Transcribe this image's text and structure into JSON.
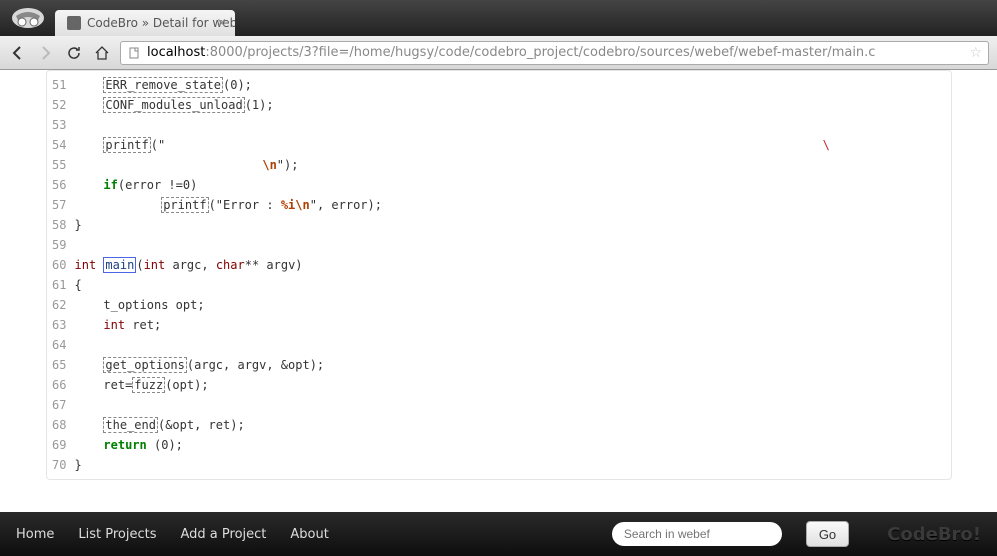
{
  "window": {
    "tab_title": "CodeBro » Detail for web"
  },
  "address": {
    "host": "localhost",
    "path": ":8000/projects/3?file=/home/hugsy/code/codebro_project/codebro/sources/webef/webef-master/main.c"
  },
  "code": {
    "lines": [
      {
        "n": 51,
        "tokens": [
          [
            "plain",
            "    "
          ],
          [
            "link",
            "ERR_remove_state"
          ],
          [
            "plain",
            "(0);"
          ]
        ]
      },
      {
        "n": 52,
        "tokens": [
          [
            "plain",
            "    "
          ],
          [
            "link",
            "CONF_modules_unload"
          ],
          [
            "plain",
            "(1);"
          ]
        ]
      },
      {
        "n": 53,
        "tokens": [
          [
            "plain",
            ""
          ]
        ]
      },
      {
        "n": 54,
        "tokens": [
          [
            "plain",
            "    "
          ],
          [
            "link",
            "printf"
          ],
          [
            "plain",
            "(\""
          ],
          [
            "plain",
            "                                                                                           "
          ],
          [
            "bs",
            "\\"
          ]
        ]
      },
      {
        "n": 55,
        "tokens": [
          [
            "plain",
            "                          "
          ],
          [
            "esc",
            "\\n"
          ],
          [
            "plain",
            "\");"
          ]
        ]
      },
      {
        "n": 56,
        "tokens": [
          [
            "plain",
            "    "
          ],
          [
            "kw",
            "if"
          ],
          [
            "plain",
            "(error !=0)"
          ]
        ]
      },
      {
        "n": 57,
        "tokens": [
          [
            "plain",
            "            "
          ],
          [
            "link",
            "printf"
          ],
          [
            "plain",
            "(\"Error : "
          ],
          [
            "esc",
            "%i"
          ],
          [
            "esc",
            "\\n"
          ],
          [
            "plain",
            "\", error);"
          ]
        ]
      },
      {
        "n": 58,
        "tokens": [
          [
            "plain",
            "}"
          ]
        ]
      },
      {
        "n": 59,
        "tokens": [
          [
            "plain",
            ""
          ]
        ]
      },
      {
        "n": 60,
        "tokens": [
          [
            "ty",
            "int"
          ],
          [
            "plain",
            " "
          ],
          [
            "linkmain",
            "main"
          ],
          [
            "plain",
            "("
          ],
          [
            "ty",
            "int"
          ],
          [
            "plain",
            " argc, "
          ],
          [
            "ty",
            "char"
          ],
          [
            "plain",
            "** argv)"
          ]
        ]
      },
      {
        "n": 61,
        "tokens": [
          [
            "plain",
            "{"
          ]
        ]
      },
      {
        "n": 62,
        "tokens": [
          [
            "plain",
            "    t_options opt;"
          ]
        ]
      },
      {
        "n": 63,
        "tokens": [
          [
            "plain",
            "    "
          ],
          [
            "ty",
            "int"
          ],
          [
            "plain",
            " ret;"
          ]
        ]
      },
      {
        "n": 64,
        "tokens": [
          [
            "plain",
            ""
          ]
        ]
      },
      {
        "n": 65,
        "tokens": [
          [
            "plain",
            "    "
          ],
          [
            "link",
            "get_options"
          ],
          [
            "plain",
            "(argc, argv, &opt);"
          ]
        ]
      },
      {
        "n": 66,
        "tokens": [
          [
            "plain",
            "    ret="
          ],
          [
            "link",
            "fuzz"
          ],
          [
            "plain",
            "(opt);"
          ]
        ]
      },
      {
        "n": 67,
        "tokens": [
          [
            "plain",
            ""
          ]
        ]
      },
      {
        "n": 68,
        "tokens": [
          [
            "plain",
            "    "
          ],
          [
            "link",
            "the_end"
          ],
          [
            "plain",
            "(&opt, ret);"
          ]
        ]
      },
      {
        "n": 69,
        "tokens": [
          [
            "plain",
            "    "
          ],
          [
            "kw",
            "return"
          ],
          [
            "plain",
            " (0);"
          ]
        ]
      },
      {
        "n": 70,
        "tokens": [
          [
            "plain",
            "}"
          ]
        ]
      }
    ]
  },
  "footer": {
    "links": [
      "Home",
      "List Projects",
      "Add a Project",
      "About"
    ],
    "search_placeholder": "Search in webef",
    "go_label": "Go",
    "brand": "CodeBro!"
  }
}
